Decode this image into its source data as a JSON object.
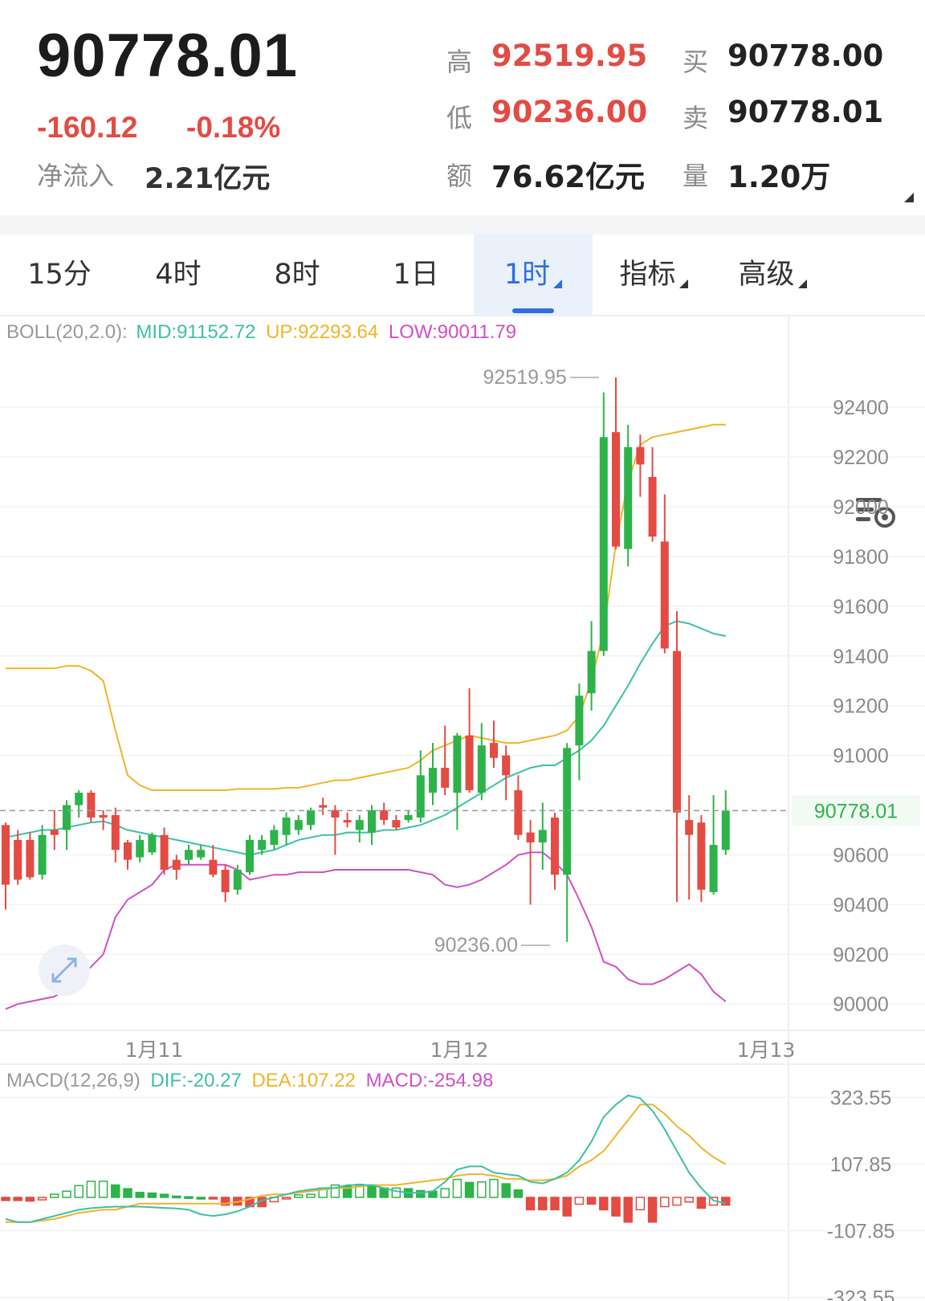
{
  "quote": {
    "last_price": "90778.01",
    "change": "-160.12",
    "change_pct": "-0.18%",
    "net_inflow_label": "净流入",
    "net_inflow_value": "2.21亿元",
    "high_label": "高",
    "high_value": "92519.95",
    "low_label": "低",
    "low_value": "90236.00",
    "amount_label": "额",
    "amount_value": "76.62亿元",
    "bid_label": "买",
    "bid_value": "90778.00",
    "ask_label": "卖",
    "ask_value": "90778.01",
    "volume_label": "量",
    "volume_value": "1.20万"
  },
  "tabs": [
    {
      "label": "15分",
      "active": false,
      "dropdown": false
    },
    {
      "label": "4时",
      "active": false,
      "dropdown": false
    },
    {
      "label": "8时",
      "active": false,
      "dropdown": false
    },
    {
      "label": "1日",
      "active": false,
      "dropdown": false
    },
    {
      "label": "1时",
      "active": true,
      "dropdown": true
    },
    {
      "label": "指标",
      "active": false,
      "dropdown": true
    },
    {
      "label": "高级",
      "active": false,
      "dropdown": true
    }
  ],
  "settings_icon": "chart-settings-icon",
  "colors": {
    "up": "#2db34a",
    "down": "#e34b43",
    "mid": "#3cc0a6",
    "upper": "#f0b429",
    "lower": "#d04fc4",
    "price_tag": "#2db34a"
  },
  "chart_data": [
    {
      "type": "candlestick",
      "indicator": {
        "label": "BOLL(20,2.0):",
        "mid": "MID:91152.72",
        "up": "UP:92293.64",
        "low": "LOW:90011.79"
      },
      "ylim": [
        89920,
        92520
      ],
      "y_ticks": [
        "92400",
        "92200",
        "92000",
        "91800",
        "91600",
        "91400",
        "91200",
        "91000",
        "90600",
        "90400",
        "90200",
        "90000"
      ],
      "last_price_tag": "90778.01",
      "x_ticks": [
        "1月11",
        "1月12",
        "1月13"
      ],
      "annotations": [
        {
          "text": "92519.95",
          "value": 92519.95,
          "candle": 49
        },
        {
          "text": "90236.00",
          "value": 90236.0,
          "candle": 45
        }
      ],
      "candles": [
        {
          "o": 90720,
          "h": 90730,
          "l": 90380,
          "c": 90480
        },
        {
          "o": 90660,
          "h": 90700,
          "l": 90480,
          "c": 90500
        },
        {
          "o": 90660,
          "h": 90690,
          "l": 90500,
          "c": 90510
        },
        {
          "o": 90520,
          "h": 90720,
          "l": 90500,
          "c": 90680
        },
        {
          "o": 90700,
          "h": 90780,
          "l": 90620,
          "c": 90680
        },
        {
          "o": 90700,
          "h": 90820,
          "l": 90620,
          "c": 90800
        },
        {
          "o": 90800,
          "h": 90860,
          "l": 90750,
          "c": 90850
        },
        {
          "o": 90850,
          "h": 90860,
          "l": 90730,
          "c": 90750
        },
        {
          "o": 90760,
          "h": 90780,
          "l": 90700,
          "c": 90750
        },
        {
          "o": 90760,
          "h": 90790,
          "l": 90570,
          "c": 90620
        },
        {
          "o": 90650,
          "h": 90660,
          "l": 90540,
          "c": 90580
        },
        {
          "o": 90590,
          "h": 90680,
          "l": 90570,
          "c": 90660
        },
        {
          "o": 90610,
          "h": 90690,
          "l": 90600,
          "c": 90680
        },
        {
          "o": 90680,
          "h": 90710,
          "l": 90520,
          "c": 90540
        },
        {
          "o": 90580,
          "h": 90600,
          "l": 90500,
          "c": 90540
        },
        {
          "o": 90580,
          "h": 90640,
          "l": 90560,
          "c": 90620
        },
        {
          "o": 90590,
          "h": 90640,
          "l": 90580,
          "c": 90620
        },
        {
          "o": 90580,
          "h": 90640,
          "l": 90510,
          "c": 90520
        },
        {
          "o": 90540,
          "h": 90560,
          "l": 90410,
          "c": 90450
        },
        {
          "o": 90460,
          "h": 90560,
          "l": 90440,
          "c": 90540
        },
        {
          "o": 90530,
          "h": 90680,
          "l": 90520,
          "c": 90660
        },
        {
          "o": 90620,
          "h": 90680,
          "l": 90600,
          "c": 90660
        },
        {
          "o": 90640,
          "h": 90720,
          "l": 90620,
          "c": 90700
        },
        {
          "o": 90680,
          "h": 90770,
          "l": 90640,
          "c": 90750
        },
        {
          "o": 90700,
          "h": 90760,
          "l": 90680,
          "c": 90740
        },
        {
          "o": 90720,
          "h": 90790,
          "l": 90700,
          "c": 90780
        },
        {
          "o": 90800,
          "h": 90830,
          "l": 90760,
          "c": 90790
        },
        {
          "o": 90780,
          "h": 90800,
          "l": 90600,
          "c": 90750
        },
        {
          "o": 90740,
          "h": 90770,
          "l": 90710,
          "c": 90730
        },
        {
          "o": 90700,
          "h": 90760,
          "l": 90650,
          "c": 90740
        },
        {
          "o": 90690,
          "h": 90800,
          "l": 90640,
          "c": 90780
        },
        {
          "o": 90780,
          "h": 90810,
          "l": 90720,
          "c": 90740
        },
        {
          "o": 90740,
          "h": 90760,
          "l": 90700,
          "c": 90710
        },
        {
          "o": 90740,
          "h": 90780,
          "l": 90730,
          "c": 90760
        },
        {
          "o": 90750,
          "h": 91020,
          "l": 90730,
          "c": 90920
        },
        {
          "o": 90850,
          "h": 91050,
          "l": 90800,
          "c": 90950
        },
        {
          "o": 90950,
          "h": 91120,
          "l": 90840,
          "c": 90870
        },
        {
          "o": 90850,
          "h": 91090,
          "l": 90700,
          "c": 91080
        },
        {
          "o": 91080,
          "h": 91270,
          "l": 90850,
          "c": 90860
        },
        {
          "o": 90850,
          "h": 91130,
          "l": 90820,
          "c": 91040
        },
        {
          "o": 91050,
          "h": 91140,
          "l": 90950,
          "c": 90990
        },
        {
          "o": 91000,
          "h": 91040,
          "l": 90820,
          "c": 90920
        },
        {
          "o": 90860,
          "h": 90920,
          "l": 90660,
          "c": 90680
        },
        {
          "o": 90690,
          "h": 90740,
          "l": 90400,
          "c": 90650
        },
        {
          "o": 90650,
          "h": 90810,
          "l": 90540,
          "c": 90700
        },
        {
          "o": 90750,
          "h": 90770,
          "l": 90460,
          "c": 90520
        },
        {
          "o": 90520,
          "h": 91050,
          "l": 90250,
          "c": 91030
        },
        {
          "o": 91040,
          "h": 91290,
          "l": 90900,
          "c": 91240
        },
        {
          "o": 91250,
          "h": 91540,
          "l": 91180,
          "c": 91420
        },
        {
          "o": 91420,
          "h": 92460,
          "l": 91400,
          "c": 92280
        },
        {
          "o": 92300,
          "h": 92520,
          "l": 91830,
          "c": 91840
        },
        {
          "o": 91830,
          "h": 92330,
          "l": 91760,
          "c": 92240
        },
        {
          "o": 92240,
          "h": 92290,
          "l": 92040,
          "c": 92170
        },
        {
          "o": 92120,
          "h": 92240,
          "l": 91860,
          "c": 91880
        },
        {
          "o": 91860,
          "h": 92050,
          "l": 91410,
          "c": 91430
        },
        {
          "o": 91420,
          "h": 91580,
          "l": 90410,
          "c": 90770
        },
        {
          "o": 90740,
          "h": 90840,
          "l": 90420,
          "c": 90680
        },
        {
          "o": 90730,
          "h": 90760,
          "l": 90410,
          "c": 90460
        },
        {
          "o": 90450,
          "h": 90840,
          "l": 90440,
          "c": 90640
        },
        {
          "o": 90620,
          "h": 90860,
          "l": 90600,
          "c": 90778.01
        }
      ],
      "boll": {
        "mid": [
          90670,
          90680,
          90690,
          90700,
          90700,
          90710,
          90720,
          90730,
          90735,
          90720,
          90700,
          90690,
          90680,
          90670,
          90660,
          90650,
          90640,
          90630,
          90620,
          90610,
          90600,
          90610,
          90620,
          90640,
          90660,
          90670,
          90680,
          90680,
          90690,
          90690,
          90690,
          90700,
          90700,
          90710,
          90720,
          90740,
          90760,
          90790,
          90820,
          90850,
          90880,
          90910,
          90930,
          90950,
          90960,
          90960,
          90990,
          91020,
          91060,
          91120,
          91200,
          91280,
          91370,
          91450,
          91520,
          91540,
          91530,
          91510,
          91490,
          91480
        ],
        "upper": [
          91350,
          91350,
          91350,
          91350,
          91350,
          91360,
          91360,
          91340,
          91300,
          91100,
          90920,
          90880,
          90860,
          90860,
          90860,
          90860,
          90860,
          90860,
          90860,
          90865,
          90865,
          90865,
          90865,
          90870,
          90870,
          90880,
          90890,
          90900,
          90900,
          90910,
          90920,
          90930,
          90940,
          90950,
          90980,
          91020,
          91040,
          91060,
          91080,
          91070,
          91060,
          91050,
          91050,
          91060,
          91070,
          91080,
          91100,
          91160,
          91300,
          91500,
          91850,
          92100,
          92250,
          92280,
          92290,
          92300,
          92310,
          92320,
          92330,
          92330
        ],
        "lower": [
          89980,
          90000,
          90010,
          90020,
          90030,
          90060,
          90100,
          90150,
          90200,
          90350,
          90420,
          90450,
          90480,
          90540,
          90560,
          90560,
          90560,
          90560,
          90560,
          90540,
          90500,
          90510,
          90520,
          90520,
          90530,
          90530,
          90530,
          90540,
          90540,
          90540,
          90540,
          90540,
          90540,
          90540,
          90530,
          90520,
          90480,
          90470,
          90480,
          90500,
          90530,
          90560,
          90600,
          90610,
          90610,
          90570,
          90520,
          90420,
          90310,
          90170,
          90150,
          90100,
          90080,
          90080,
          90100,
          90130,
          90160,
          90120,
          90050,
          90010
        ]
      }
    },
    {
      "type": "bar+line",
      "indicator": {
        "label": "MACD(12,26,9)",
        "dif": "DIF:-20.27",
        "dea": "DEA:107.22",
        "macd": "MACD:-254.98"
      },
      "ylim": [
        -335,
        340
      ],
      "y_ticks": [
        "323.55",
        "107.85",
        "-107.85",
        "-323.55"
      ],
      "hist": [
        -10,
        -10,
        -12,
        -8,
        10,
        20,
        38,
        52,
        52,
        40,
        28,
        16,
        14,
        10,
        4,
        2,
        0,
        -5,
        -25,
        -25,
        -30,
        -30,
        -14,
        -2,
        8,
        10,
        30,
        40,
        38,
        42,
        40,
        30,
        30,
        28,
        22,
        20,
        28,
        58,
        48,
        50,
        58,
        44,
        24,
        -40,
        -40,
        -40,
        -60,
        -22,
        -22,
        -40,
        -60,
        -80,
        -40,
        -80,
        -30,
        -25,
        -15,
        -35,
        -25,
        -25
      ],
      "dif": [
        -70,
        -80,
        -80,
        -70,
        -60,
        -50,
        -40,
        -35,
        -32,
        -30,
        -30,
        -30,
        -32,
        -34,
        -36,
        -40,
        -55,
        -60,
        -55,
        -45,
        -30,
        -10,
        0,
        10,
        20,
        25,
        30,
        30,
        40,
        40,
        40,
        30,
        20,
        15,
        15,
        20,
        50,
        90,
        100,
        100,
        80,
        75,
        70,
        50,
        45,
        60,
        80,
        120,
        180,
        260,
        300,
        330,
        320,
        280,
        220,
        150,
        80,
        30,
        -10,
        -20
      ],
      "dea": [
        -80,
        -80,
        -80,
        -75,
        -70,
        -60,
        -50,
        -45,
        -40,
        -40,
        -30,
        -20,
        -20,
        -20,
        -20,
        -20,
        -20,
        -20,
        -20,
        -15,
        -5,
        5,
        10,
        10,
        15,
        20,
        25,
        30,
        30,
        35,
        40,
        40,
        40,
        45,
        50,
        55,
        60,
        70,
        75,
        75,
        70,
        60,
        60,
        55,
        55,
        60,
        70,
        100,
        120,
        150,
        200,
        250,
        300,
        300,
        270,
        230,
        200,
        160,
        130,
        107
      ]
    }
  ]
}
